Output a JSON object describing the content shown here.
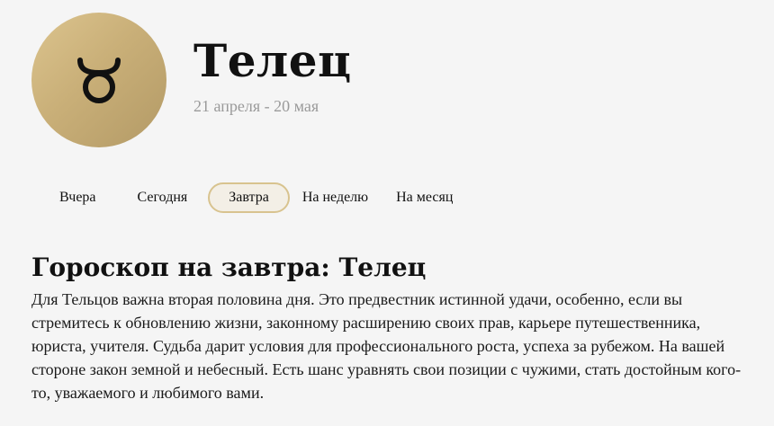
{
  "header": {
    "icon": "taurus-icon",
    "title": "Телец",
    "dates": "21 апреля - 20 мая",
    "badge_colors": [
      "#dcc48e",
      "#b39a66"
    ]
  },
  "tabs": [
    {
      "label": "Вчера",
      "active": false
    },
    {
      "label": "Сегодня",
      "active": false
    },
    {
      "label": "Завтра",
      "active": true
    },
    {
      "label": "На неделю",
      "active": false
    },
    {
      "label": "На месяц",
      "active": false
    }
  ],
  "content": {
    "title": "Гороскоп на завтра: Телец",
    "text": "Для Тельцов важна вторая половина дня. Это предвестник истинной удачи, особенно, если вы стремитесь к обновлению жизни, законному расширению своих прав, карьере путешественника, юриста, учителя. Судьба дарит условия для профессионального роста, успеха за рубежом. На вашей стороне закон земной и небесный. Есть шанс уравнять свои позиции с чужими, стать достойным кого-то, уважаемого и любимого вами."
  },
  "colors": {
    "accent_border": "#d8c38f",
    "active_tab_bg": "#f3efe6",
    "dates_text": "#9a9a9a",
    "page_bg": "#f5f5f5"
  }
}
